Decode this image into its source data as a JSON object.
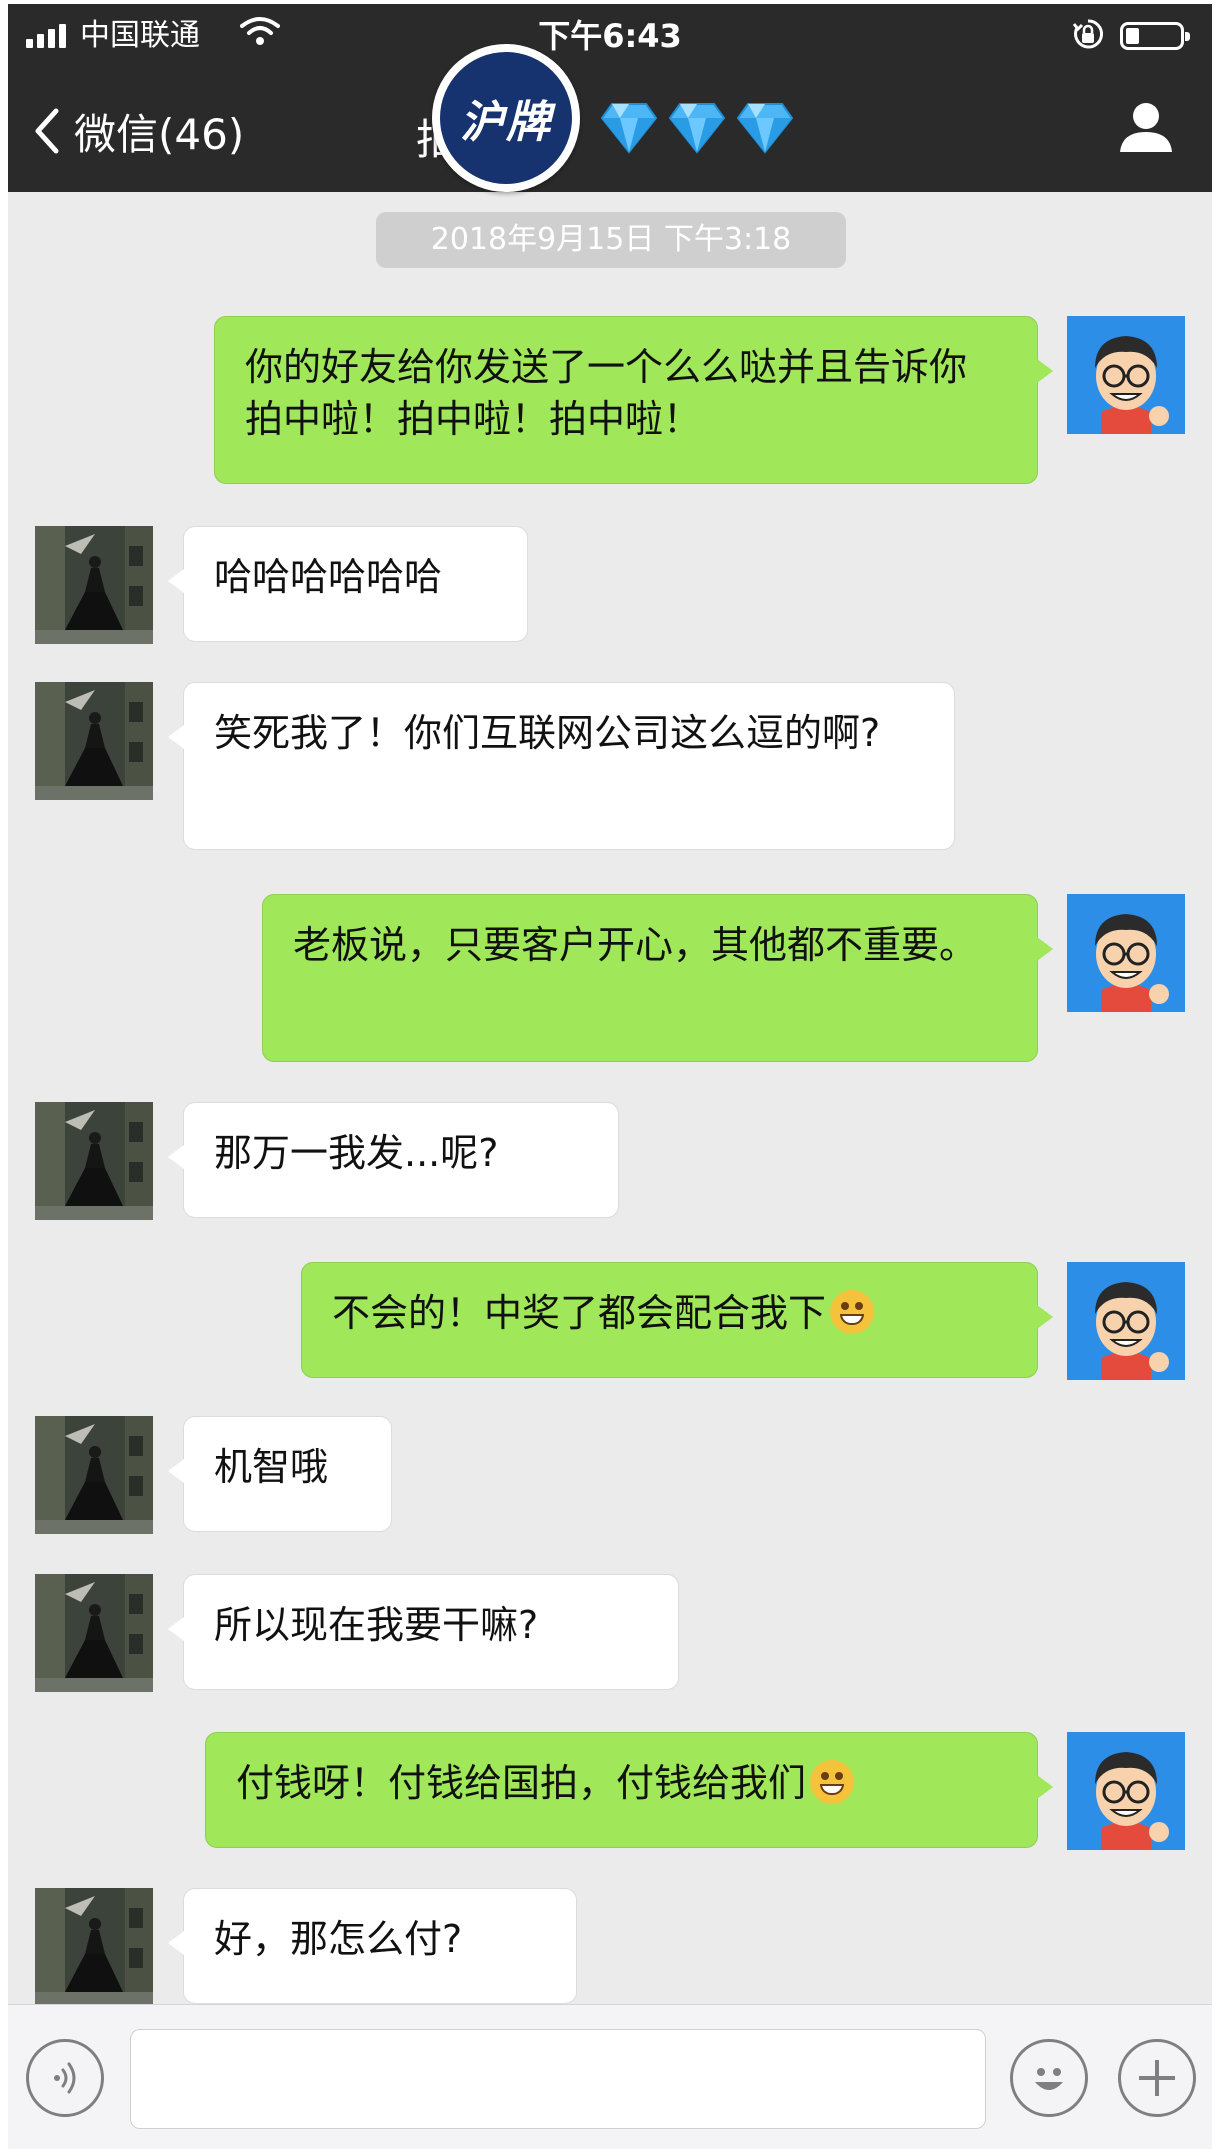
{
  "status_bar": {
    "carrier": "中国联通",
    "time": "下午6:43",
    "battery_level_percent": 25
  },
  "nav": {
    "back_label": "微信(46)",
    "title_partial": "拍",
    "badge_text": "沪牌",
    "diamond_count": 3
  },
  "chat": {
    "timestamp": "2018年9月15日 下午3:18",
    "messages": [
      {
        "side": "right",
        "text": "你的好友给你发送了一个么么哒并且告诉你 拍中啦！拍中啦！拍中啦！"
      },
      {
        "side": "left",
        "text": "哈哈哈哈哈哈"
      },
      {
        "side": "left",
        "text": "笑死我了！你们互联网公司这么逗的啊?"
      },
      {
        "side": "right",
        "text": "老板说，只要客户开心，其他都不重要。"
      },
      {
        "side": "left",
        "text": "那万一我发...呢?"
      },
      {
        "side": "right",
        "text": "不会的！中奖了都会配合我下",
        "emoji": "grinning-emoji"
      },
      {
        "side": "left",
        "text": "机智哦"
      },
      {
        "side": "left",
        "text": "所以现在我要干嘛?"
      },
      {
        "side": "right",
        "text": "付钱呀！付钱给国拍，付钱给我们",
        "emoji": "star-eyes-emoji"
      },
      {
        "side": "left",
        "text": "好，那怎么付?"
      }
    ]
  },
  "input_bar": {
    "value": "",
    "icons": [
      "voice-icon",
      "emoji-icon",
      "plus-icon"
    ]
  },
  "colors": {
    "nav_bg": "#2a2a2a",
    "chat_bg": "#ebebeb",
    "my_bubble": "#a0e75a",
    "their_bubble": "#ffffff",
    "badge_bg": "#16326f"
  }
}
